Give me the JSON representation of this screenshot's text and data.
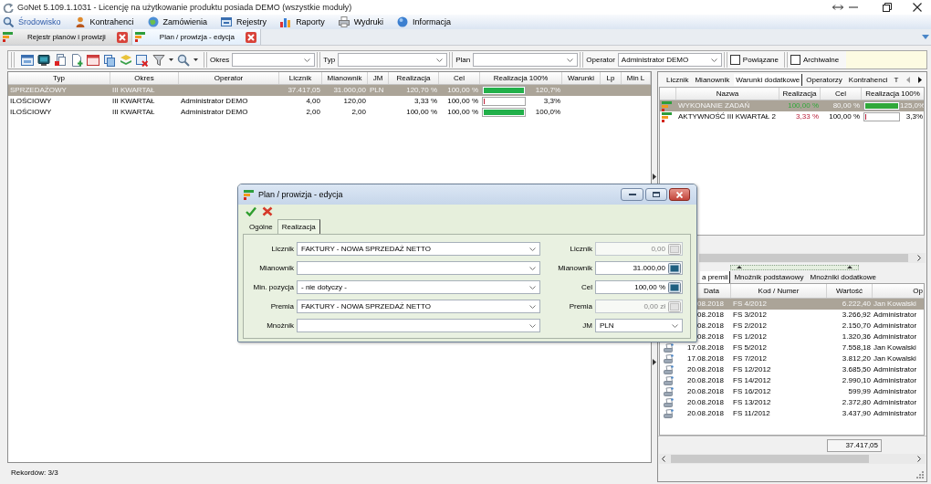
{
  "window": {
    "title": "GoNet 5.109.1.1031 - Licencję na użytkowanie produktu posiada DEMO (wszystkie moduły)"
  },
  "menu": [
    {
      "label": "Środowisko",
      "highlighted": true
    },
    {
      "label": "Kontrahenci",
      "highlighted": false
    },
    {
      "label": "Zamówienia",
      "highlighted": false
    },
    {
      "label": "Rejestry",
      "highlighted": false
    },
    {
      "label": "Raporty",
      "highlighted": false
    },
    {
      "label": "Wydruki",
      "highlighted": false
    },
    {
      "label": "Informacja",
      "highlighted": false
    }
  ],
  "document_tabs": [
    {
      "label": "Rejestr planów i prowizji",
      "selected": false
    },
    {
      "label": "Plan / prowizja - edycja",
      "selected": true
    }
  ],
  "toolbar": {
    "filters": [
      {
        "label": "Okres"
      },
      {
        "label": "Typ"
      },
      {
        "label": "Plan"
      },
      {
        "label": "Operator",
        "value": "Administrator DEMO"
      }
    ],
    "checkboxes": [
      {
        "label": "Powiązane",
        "checked": false
      },
      {
        "label": "Archiwalne",
        "checked": false
      }
    ]
  },
  "plans_table": {
    "columns": [
      "Typ",
      "Okres",
      "Operator",
      "Licznik",
      "Mianownik",
      "JM",
      "Realizacja",
      "Cel",
      "Realizacja 100%",
      "Warunki",
      "Lp",
      "Min L"
    ],
    "rows": [
      {
        "type": "SPRZEDAŻOWY",
        "period": "III KWARTAŁ",
        "counter": "37.417,05",
        "denominator": "31.000,00",
        "unit": "PLN",
        "realization": "120,70 %",
        "target": "100,00 %",
        "level": 1,
        "reading": "120,7%",
        "color": "#22b04a",
        "selected": true
      },
      {
        "type": "ILOŚCIOWY",
        "period": "III KWARTAŁ",
        "operator": "Administrator DEMO",
        "counter": "4,00",
        "denominator": "120,00",
        "realization": "3,33 %",
        "target": "100,00 %",
        "level": 0.033,
        "reading": "3,3%",
        "color": "#c0203a",
        "selected": false
      },
      {
        "type": "ILOŚCIOWY",
        "period": "III KWARTAŁ",
        "operator": "Administrator DEMO",
        "counter": "2,00",
        "denominator": "2,00",
        "realization": "100,00 %",
        "target": "100,00 %",
        "level": 1,
        "reading": "100,0%",
        "color": "#22b04a",
        "selected": false
      }
    ]
  },
  "right_panel": {
    "tabs": [
      {
        "label": "Licznik",
        "selected": false
      },
      {
        "label": "Mianownik",
        "selected": false
      },
      {
        "label": "Warunki dodatkowe",
        "selected": true
      },
      {
        "label": "Operatorzy",
        "selected": false
      },
      {
        "label": "Kontrahenci",
        "selected": false
      },
      {
        "label": "T",
        "selected": false
      }
    ],
    "conditions_table": {
      "columns": [
        "Nazwa",
        "Realizacja",
        "Cel",
        "Realizacja 100%"
      ],
      "rows": [
        {
          "name": "WYKONANIE ZADAŃ",
          "realization": "100,00 %",
          "target": "80,00 %",
          "level": 1,
          "reading": "125,0%",
          "color": "#2fa83a",
          "selected": true
        },
        {
          "name": "AKTYWNOŚĆ III KWARTAŁ 2",
          "realization": "3,33 %",
          "target": "100,00 %",
          "level": 0.033,
          "reading": "3,3%",
          "color": "#b8203a",
          "selected": false
        }
      ]
    },
    "lower_tabs": [
      {
        "label": "a premii",
        "selected": true
      },
      {
        "label": "Mnożnik podstawowy",
        "selected": false
      },
      {
        "label": "Mnożniki dodatkowe",
        "selected": false
      }
    ],
    "documents_table": {
      "columns": [
        "Data",
        "Kod / Numer",
        "Wartość",
        "Op"
      ],
      "rows": [
        {
          "date": "08.2018",
          "code": "FS 4/2012",
          "value": "6.222,40",
          "operator": "Jan Kowalski",
          "selected": true
        },
        {
          "date": "08.2018",
          "code": "FS 3/2012",
          "value": "3.266,92",
          "operator": "Administrator",
          "selected": false
        },
        {
          "date": "08.2018",
          "code": "FS 2/2012",
          "value": "2.150,70",
          "operator": "Administrator",
          "selected": false
        },
        {
          "date": "08.2018",
          "code": "FS 1/2012",
          "value": "1.320,36",
          "operator": "Administrator",
          "selected": false
        },
        {
          "date": "17.08.2018",
          "code": "FS 5/2012",
          "value": "7.558,18",
          "operator": "Jan Kowalski",
          "selected": false
        },
        {
          "date": "17.08.2018",
          "code": "FS 7/2012",
          "value": "3.812,20",
          "operator": "Jan Kowalski",
          "selected": false
        },
        {
          "date": "20.08.2018",
          "code": "FS 12/2012",
          "value": "3.685,50",
          "operator": "Administrator",
          "selected": false
        },
        {
          "date": "20.08.2018",
          "code": "FS 14/2012",
          "value": "2.990,10",
          "operator": "Administrator",
          "selected": false
        },
        {
          "date": "20.08.2018",
          "code": "FS 16/2012",
          "value": "599,99",
          "operator": "Administrator",
          "selected": false
        },
        {
          "date": "20.08.2018",
          "code": "FS 13/2012",
          "value": "2.372,80",
          "operator": "Administrator",
          "selected": false
        },
        {
          "date": "20.08.2018",
          "code": "FS 11/2012",
          "value": "3.437,90",
          "operator": "Administrator",
          "selected": false
        }
      ],
      "total": "37.417,05"
    }
  },
  "dialog": {
    "title": "Plan / prowizja - edycja",
    "tabs": [
      {
        "label": "Ogólne",
        "selected": false
      },
      {
        "label": "Realizacja",
        "selected": true
      }
    ],
    "left_fields": [
      {
        "label": "Licznik",
        "value": "FAKTURY - NOWA SPRZEDAŻ NETTO"
      },
      {
        "label": "Mianownik"
      },
      {
        "label": "Min. pozycja",
        "value": "- nie dotyczy -"
      },
      {
        "label": "Premia",
        "value": "FAKTURY - NOWA SPRZEDAŻ NETTO"
      },
      {
        "label": "Mnożnik"
      }
    ],
    "right_fields": [
      {
        "label": "Licznik",
        "kind": "calc",
        "value": "0,00",
        "disabled": true
      },
      {
        "label": "Mianownik",
        "kind": "calc",
        "value": "31.000,00",
        "disabled": false
      },
      {
        "label": "Cel",
        "kind": "calc",
        "value": "100,00 %",
        "disabled": false
      },
      {
        "label": "Premia",
        "kind": "calc",
        "value": "0,00 zł",
        "disabled": true
      },
      {
        "label": "JM",
        "kind": "combo",
        "value": "PLN"
      }
    ]
  },
  "status_bar": {
    "text": "Rekordów: 3/3"
  }
}
